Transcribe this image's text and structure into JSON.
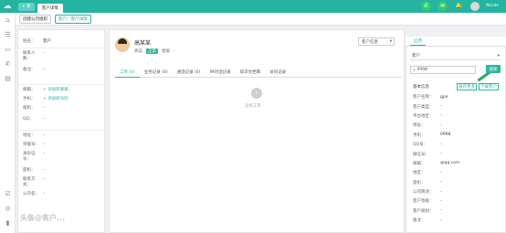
{
  "topbar": {
    "new_button": "+ 新",
    "tab_label": "客户详情",
    "user_name": "Nicole"
  },
  "subbar": {
    "crumbs": [
      "创建公司组织",
      "客户：客户详情"
    ]
  },
  "left_panel": {
    "rows": [
      {
        "label": "姓名：",
        "value": "客户"
      },
      {
        "label": "联系人数：",
        "value": "-"
      },
      {
        "label": "备注：",
        "value": "-"
      },
      {
        "label": "邮箱：",
        "value": "+ 添加新邮箱"
      },
      {
        "label": "手机：",
        "value": "+ 添加新号码"
      },
      {
        "label": "座机：",
        "value": "-"
      },
      {
        "label": "QQ：",
        "value": "-"
      },
      {
        "label": "地址：",
        "value": "-"
      },
      {
        "label": "单据号：",
        "value": "-"
      },
      {
        "label": "身份证号：",
        "value": "-"
      },
      {
        "label": "座机：",
        "value": "-"
      },
      {
        "label": "联系方式：",
        "value": "-"
      },
      {
        "label": "公司名：",
        "value": "-"
      }
    ],
    "watermark": "头条@客户..."
  },
  "center": {
    "customer_name": "高某某",
    "status_label": "状态",
    "status_badge": "正常",
    "star_label": "星级",
    "star_value": "-",
    "select_label": "客户信息",
    "tabs": [
      "工单 (0)",
      "业务记录 (0)",
      "通话记录 (0)",
      "IM对话记录",
      "知识文档库",
      "访问记录"
    ],
    "empty_text": "没有工单"
  },
  "right_panel": {
    "tab": "应用",
    "select_value": "客户",
    "search_value": "0998",
    "search_button": "搜索",
    "section_title": "基本信息",
    "link1": "展开更多",
    "link2": "下载客户",
    "items": [
      {
        "k": "客户名称：",
        "v": "gpe"
      },
      {
        "k": "客户类型：",
        "v": "-"
      },
      {
        "k": "平台地区：",
        "v": "-"
      },
      {
        "k": "地址：",
        "v": "-"
      },
      {
        "k": "手机：",
        "v": "0998"
      },
      {
        "k": "QQ号：",
        "v": "-"
      },
      {
        "k": "微信号：",
        "v": "-"
      },
      {
        "k": "邮箱：",
        "v": "@qq.com"
      },
      {
        "k": "地区：",
        "v": "-"
      },
      {
        "k": "座机：",
        "v": "-"
      },
      {
        "k": "公司简述：",
        "v": "-"
      },
      {
        "k": "客户等级：",
        "v": "-"
      },
      {
        "k": "客户级别：",
        "v": "-"
      },
      {
        "k": "备注：",
        "v": "-"
      }
    ]
  },
  "colors": {
    "brand": "#25b3a2",
    "accent": "#2fb59f",
    "online": "#2ecc71"
  }
}
